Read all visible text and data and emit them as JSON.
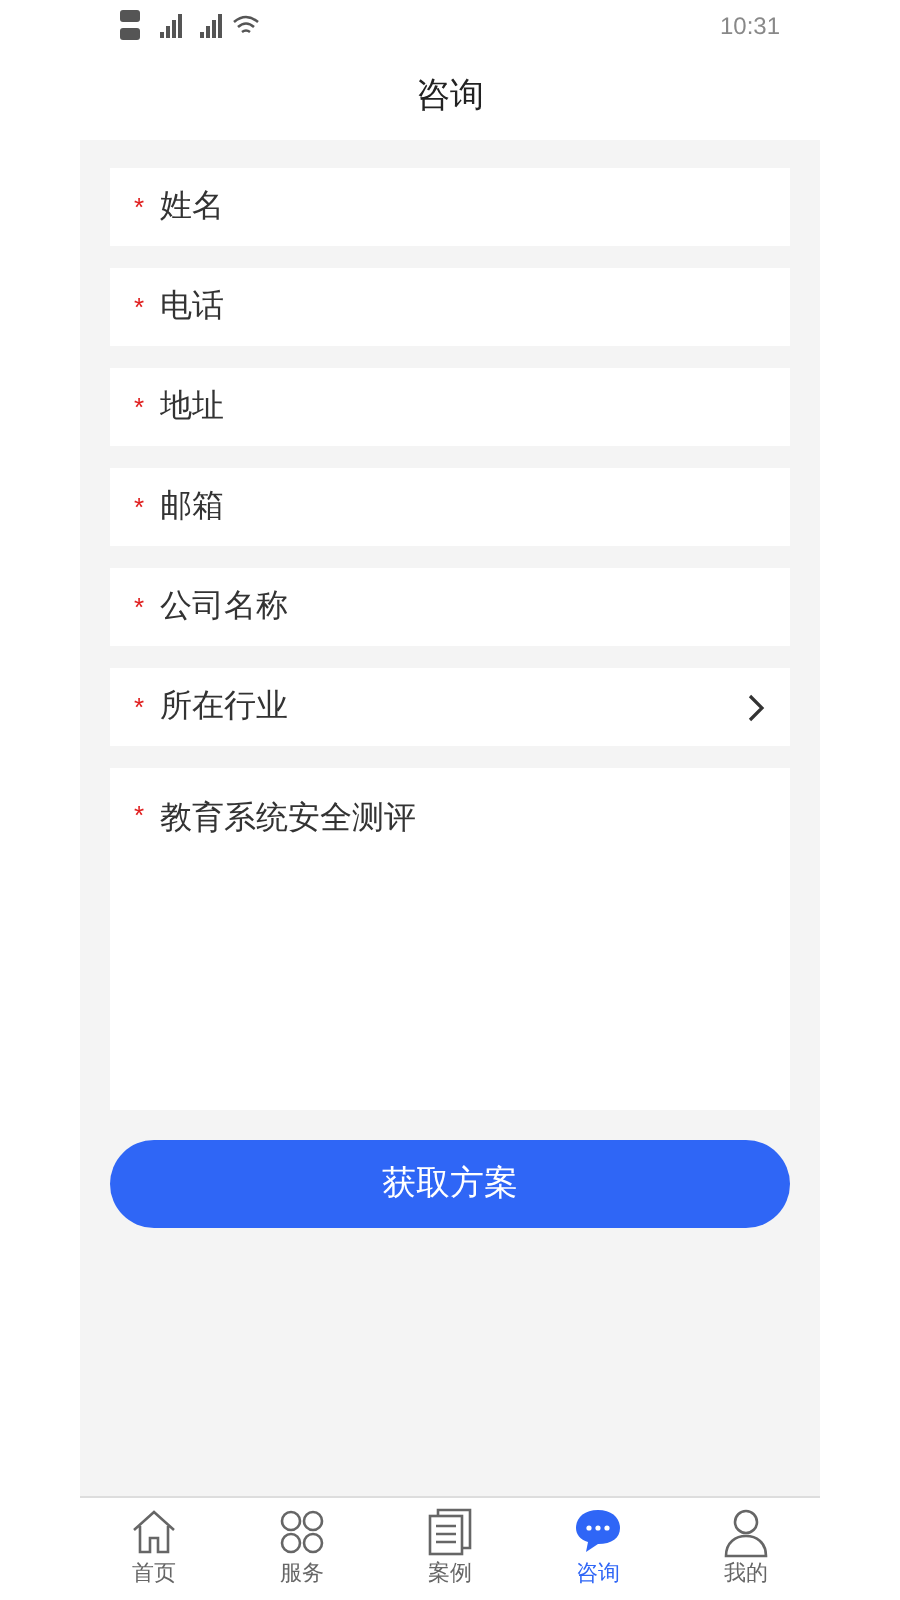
{
  "status_bar": {
    "time": "10:31"
  },
  "header": {
    "title": "咨询"
  },
  "form": {
    "fields": [
      {
        "kind": "text",
        "mark": "*",
        "label": "姓名"
      },
      {
        "kind": "text",
        "mark": "*",
        "label": "电话"
      },
      {
        "kind": "text",
        "mark": "*",
        "label": "地址"
      },
      {
        "kind": "text",
        "mark": "*",
        "label": "邮箱"
      },
      {
        "kind": "text",
        "mark": "*",
        "label": "公司名称"
      },
      {
        "kind": "select",
        "mark": "*",
        "label": "所在行业"
      },
      {
        "kind": "textarea",
        "mark": "*",
        "label": "教育系统安全测评"
      }
    ],
    "submit": "获取方案"
  },
  "tab_bar": [
    {
      "kind": "home",
      "label": "首页",
      "selected": false
    },
    {
      "kind": "services",
      "label": "服务",
      "selected": false
    },
    {
      "kind": "cases",
      "label": "案例",
      "selected": false
    },
    {
      "kind": "consult",
      "label": "咨询",
      "selected": true
    },
    {
      "kind": "profile",
      "label": "我的",
      "selected": false
    }
  ]
}
